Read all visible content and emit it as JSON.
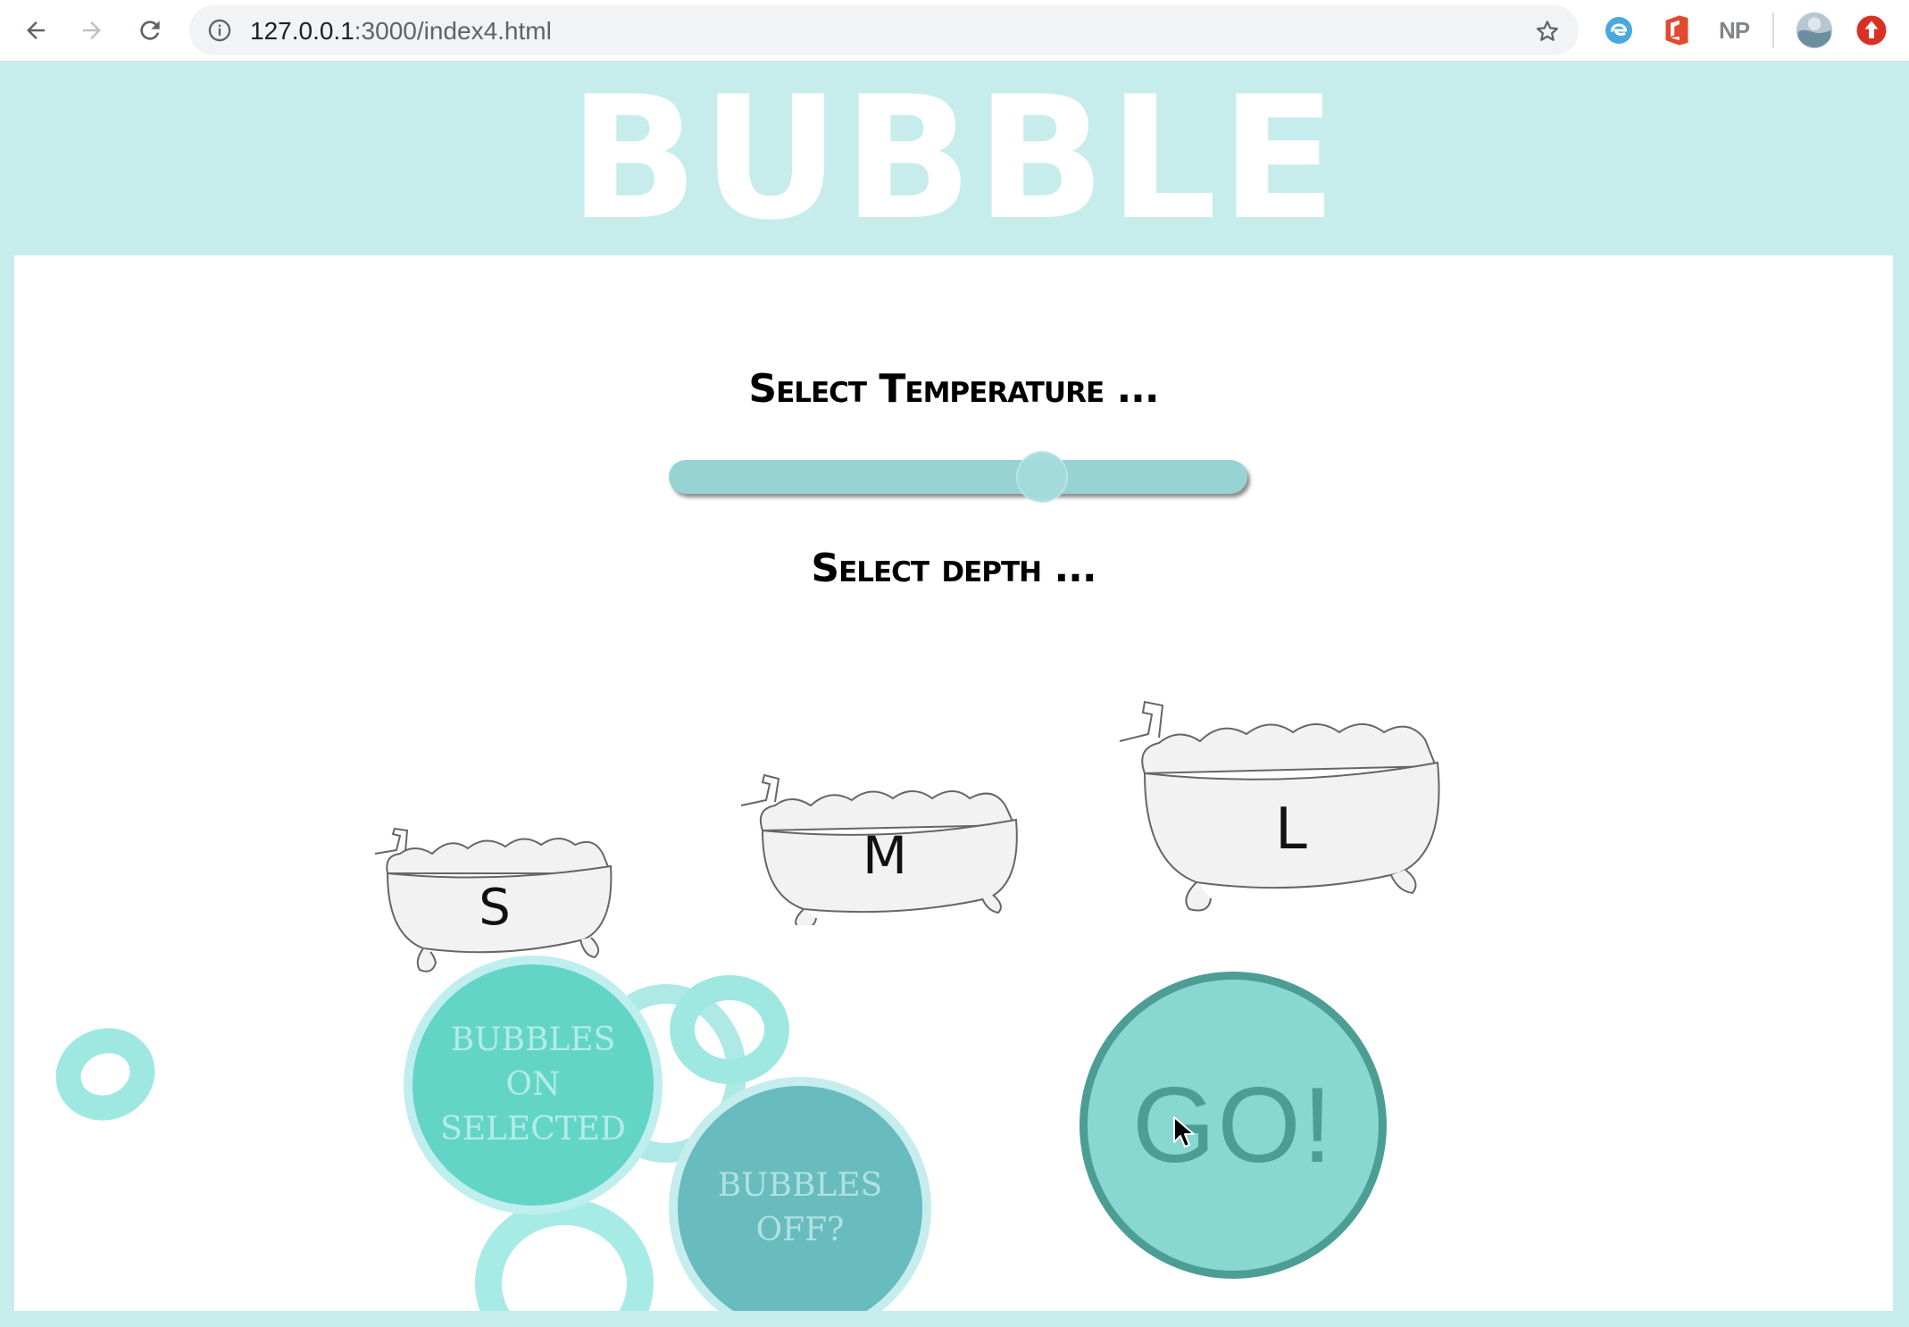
{
  "browser": {
    "url_host": "127.0.0.1",
    "url_path": ":3000/index4.html",
    "extensions": [
      "edge-extension-icon",
      "office-icon",
      "NP",
      "profile-avatar-icon",
      "adblock-icon"
    ]
  },
  "header": {
    "title": "BUBBLE"
  },
  "temperature": {
    "label": "Select Temperature ...",
    "slider_value_fraction": 0.66
  },
  "depth": {
    "label": "Select depth ...",
    "options": [
      {
        "label": "S"
      },
      {
        "label": "M"
      },
      {
        "label": "L"
      }
    ]
  },
  "buttons": {
    "bubbles_on": "BUBBLES ON SELECTED",
    "bubbles_off": "BUBBLES OFF?",
    "go": "GO!"
  },
  "colors": {
    "header_bg": "#c7ecec",
    "slider": "#97d3d3",
    "bubble_ring": "#9fe8e2",
    "go_border": "#4c9e95"
  }
}
